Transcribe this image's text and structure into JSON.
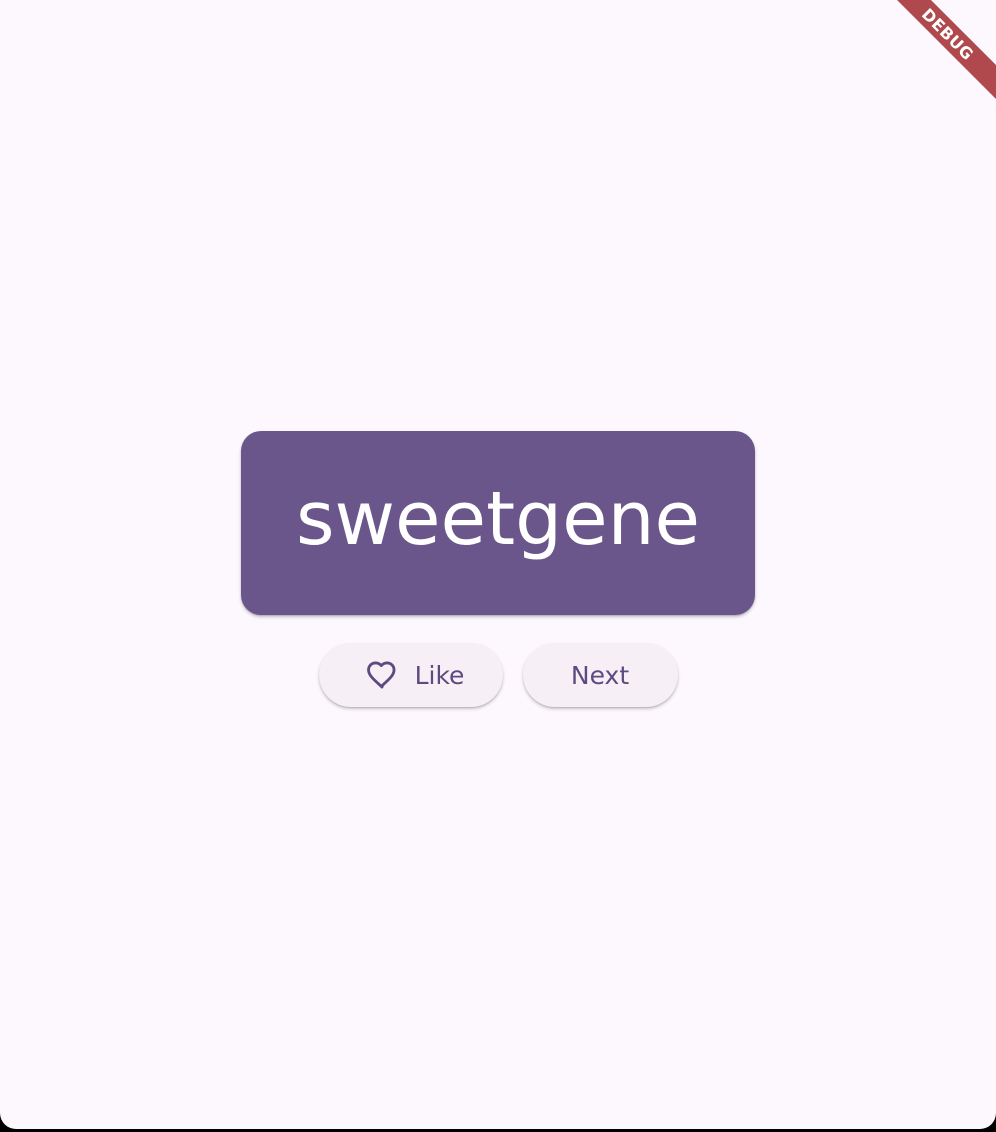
{
  "app": {
    "word": "sweetgene",
    "debug_banner": "DEBUG"
  },
  "actions": {
    "like_label": "Like",
    "next_label": "Next"
  },
  "icons": {
    "like": "heart-outline-icon"
  },
  "colors": {
    "background": "#fdf7fe",
    "primary": "#6b568c",
    "button_background": "#f6eff6",
    "button_text": "#5c4a80",
    "debug_banner": "#b0494d"
  }
}
